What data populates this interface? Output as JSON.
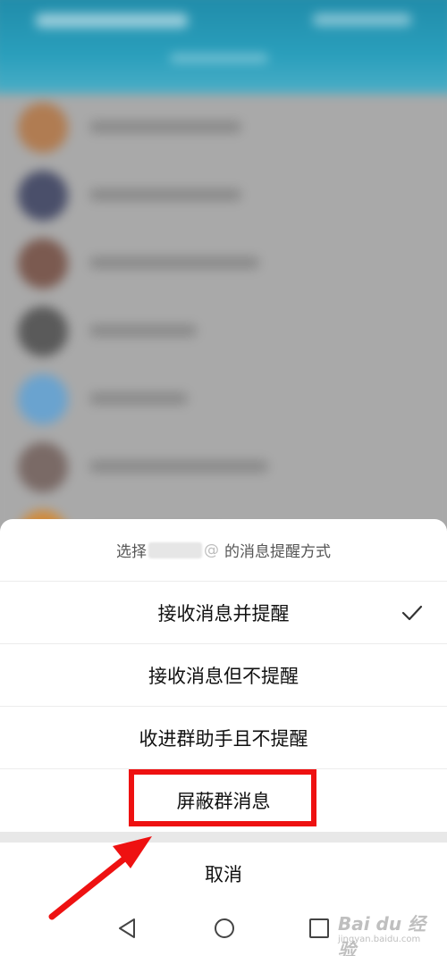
{
  "sheet": {
    "title_prefix": "选择",
    "title_name_tail": "@",
    "title_suffix": "的消息提醒方式",
    "options": [
      {
        "label": "接收消息并提醒",
        "selected": true
      },
      {
        "label": "接收消息但不提醒",
        "selected": false
      },
      {
        "label": "收进群助手且不提醒",
        "selected": false
      },
      {
        "label": "屏蔽群消息",
        "selected": false,
        "highlighted": true
      }
    ],
    "cancel_label": "取消"
  },
  "icons": {
    "check": "checkmark-icon",
    "nav_back": "triangle-back-icon",
    "nav_home": "circle-home-icon",
    "nav_recent": "square-recent-icon"
  },
  "watermark": {
    "logo_text": "Bai du 经验",
    "sub_text": "jingyan.baidu.com"
  },
  "colors": {
    "highlight_red": "#ee1111",
    "header_teal": "#2a9fbc"
  }
}
